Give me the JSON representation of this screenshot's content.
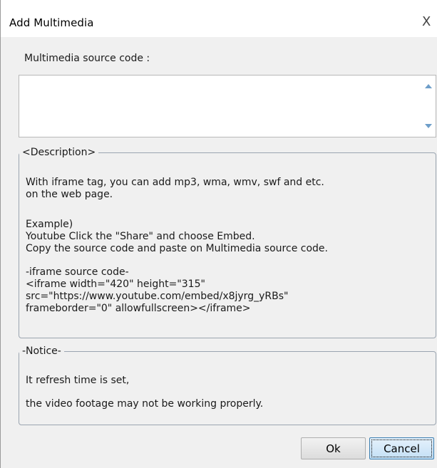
{
  "dialog": {
    "title": "Add Multimedia",
    "close_glyph": "X"
  },
  "source": {
    "label": "Multimedia source code :",
    "value": ""
  },
  "description": {
    "legend": "<Description>",
    "lines": [
      "With iframe tag, you can add mp3, wma, wmv, swf and etc.",
      "on the web page.",
      "Example)",
      "Youtube Click the \"Share\" and choose Embed.",
      "Copy the source code and paste on Multimedia source code.",
      "-iframe source code-",
      "<iframe width=\"420\" height=\"315\"",
      "src=\"https://www.youtube.com/embed/x8jyrg_yRBs\"",
      "frameborder=\"0\" allowfullscreen></iframe>"
    ]
  },
  "notice": {
    "legend": "-Notice-",
    "lines": [
      "It refresh time is set,",
      "the video footage may not be working properly."
    ]
  },
  "buttons": {
    "ok": "Ok",
    "cancel": "Cancel"
  },
  "icons": {
    "close": "close-icon",
    "scroll_up": "scroll-up-arrow-icon",
    "scroll_down": "scroll-down-arrow-icon"
  },
  "colors": {
    "dialog_bg": "#f0f0f0",
    "scroll_arrow": "#6e9ec9",
    "default_button_border": "#3c7fb1"
  }
}
